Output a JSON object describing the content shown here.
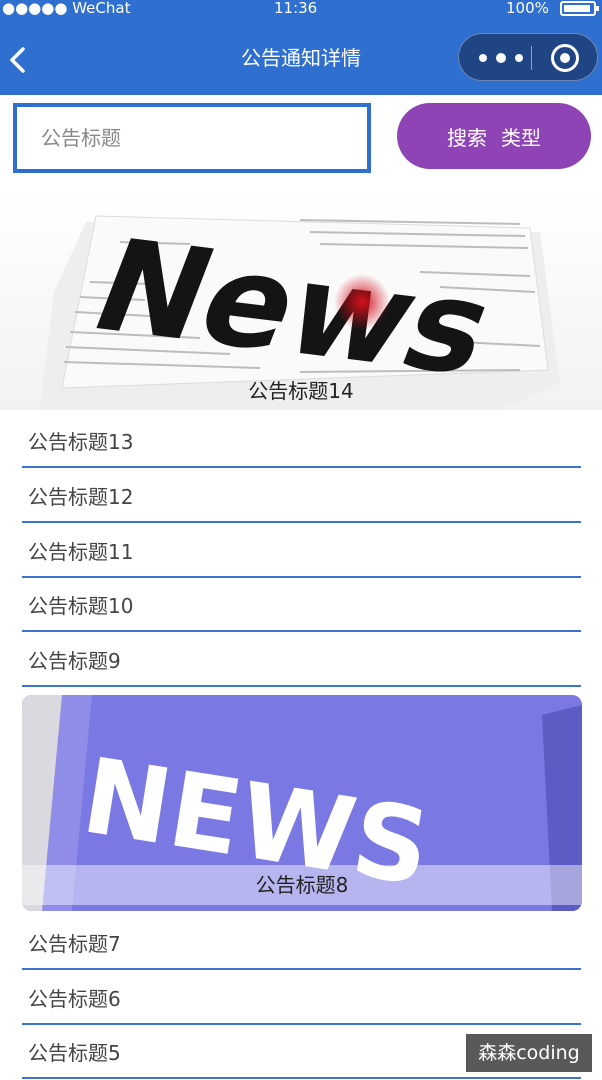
{
  "status_bar": {
    "carrier": "●●●●● WeChat",
    "time": "11:36",
    "battery": "100%"
  },
  "nav": {
    "title": "公告通知详情"
  },
  "search": {
    "placeholder": "公告标题",
    "button_label": "搜索",
    "type_label": "类型"
  },
  "featured": [
    {
      "image": "newspaper-news-image",
      "image_text": "News",
      "caption": "公告标题14"
    },
    {
      "image": "news-keyboard-key-image",
      "image_text": "NEWS",
      "caption": "公告标题8"
    }
  ],
  "list_group_1": [
    "公告标题13",
    "公告标题12",
    "公告标题11",
    "公告标题10",
    "公告标题9"
  ],
  "list_group_2": [
    "公告标题7",
    "公告标题6",
    "公告标题5"
  ],
  "watermark": "森森coding",
  "colors": {
    "nav_bg": "#2f6fd0",
    "search_button": "#8e44b5",
    "divider": "#3a74cc"
  }
}
